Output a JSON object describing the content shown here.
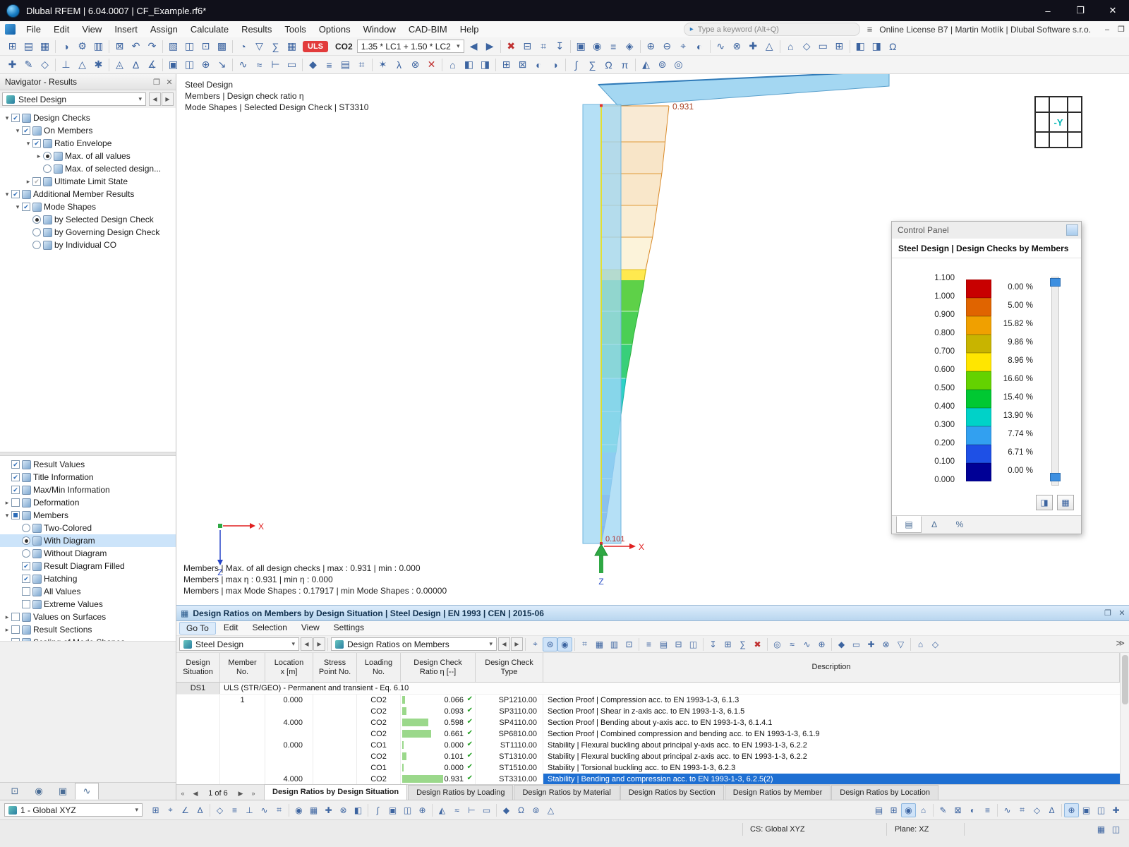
{
  "ui": {
    "dd": "▾",
    "prev": "◀",
    "next": "▶",
    "close": "✕",
    "float": "❐",
    "pin": "▣",
    "menu": "≡",
    "min": "–",
    "max": "❐",
    "search_arrow": "▸",
    "pager_first": "«",
    "pager_prev": "◀",
    "pager_next": "▶",
    "pager_last": "»",
    "overflow": "≫"
  },
  "titlebar": {
    "app_title": "Dlubal RFEM | 6.04.0007 | CF_Example.rf6*",
    "window_buttons": {
      "minimize": "–",
      "maximize": "❐",
      "close": "✕"
    }
  },
  "menubar": {
    "items": [
      "File",
      "Edit",
      "View",
      "Insert",
      "Assign",
      "Calculate",
      "Results",
      "Tools",
      "Options",
      "Window",
      "CAD-BIM",
      "Help"
    ],
    "search_placeholder": "Type a keyword (Alt+Q)",
    "license_text": "Online License B7 | Martin Motlík | Dlubal Software s.r.o."
  },
  "toolbar": {
    "uls_badge": "ULS",
    "co_label": "CO2",
    "load_combo_value": "1.35 * LC1 + 1.50 * LC2",
    "row1_icons_a": [
      "⊞",
      "▤",
      "▦",
      "|",
      "◑",
      "⚙",
      "▥",
      "|",
      "⊠",
      "↶",
      "↷",
      "|",
      "▧",
      "◫",
      "⊡",
      "▩",
      "|",
      "◔",
      "▽",
      "∑",
      "▦"
    ],
    "row1_icons_b": [
      "◀",
      "▶",
      "|",
      "✖",
      "⊟",
      "⌗",
      "↧",
      "|",
      "▣",
      "◉",
      "≡",
      "◈",
      "|",
      "⊕",
      "⊖",
      "⌖",
      "◐",
      "|",
      "∿",
      "⊗",
      "✚",
      "△",
      "|",
      "⌂",
      "◇",
      "▭",
      "⊞",
      "|",
      "◧",
      "◨",
      "Ω"
    ],
    "row2_icons": [
      "✚",
      "✎",
      "◇",
      "|",
      "⊥",
      "△",
      "✱",
      "|",
      "◬",
      "∆",
      "∡",
      "|",
      "▣",
      "◫",
      "⊕",
      "↘",
      "|",
      "∿",
      "≈",
      "⊢",
      "▭",
      "|",
      "◆",
      "≡",
      "▤",
      "⌗",
      "|",
      "✶",
      "λ",
      "⊗",
      "✕",
      "|",
      "⌂",
      "◧",
      "◨",
      "|",
      "⊞",
      "⊠",
      "◐",
      "◑",
      "|",
      "∫",
      "∑",
      "Ω",
      "π",
      "|",
      "◭",
      "⊚",
      "◎"
    ]
  },
  "navigator": {
    "panel_title": "Navigator - Results",
    "combo_value": "Steel Design",
    "tree_top": [
      {
        "lvl": 0,
        "exp": "open",
        "ctrl": "checkbox",
        "state": "checked",
        "label": "Design Checks"
      },
      {
        "lvl": 1,
        "exp": "open",
        "ctrl": "checkbox",
        "state": "checked",
        "label": "On Members"
      },
      {
        "lvl": 2,
        "exp": "open",
        "ctrl": "checkbox",
        "state": "checked",
        "label": "Ratio Envelope"
      },
      {
        "lvl": 3,
        "exp": "closed",
        "ctrl": "radio",
        "state": "selected",
        "label": "Max. of all values"
      },
      {
        "lvl": 3,
        "exp": "none",
        "ctrl": "radio",
        "state": "unselected",
        "label": "Max. of selected design..."
      },
      {
        "lvl": 2,
        "exp": "closed",
        "ctrl": "checkbox",
        "state": "checked-dim",
        "label": "Ultimate Limit State"
      },
      {
        "lvl": 0,
        "exp": "open",
        "ctrl": "checkbox",
        "state": "checked",
        "label": "Additional Member Results"
      },
      {
        "lvl": 1,
        "exp": "open",
        "ctrl": "checkbox",
        "state": "checked",
        "label": "Mode Shapes"
      },
      {
        "lvl": 2,
        "exp": "none",
        "ctrl": "radio",
        "state": "selected",
        "label": "by Selected Design Check"
      },
      {
        "lvl": 2,
        "exp": "none",
        "ctrl": "radio",
        "state": "unselected",
        "label": "by Governing Design Check"
      },
      {
        "lvl": 2,
        "exp": "none",
        "ctrl": "radio",
        "state": "unselected",
        "label": "by Individual CO"
      }
    ],
    "tree_bottom": [
      {
        "lvl": 0,
        "exp": "none",
        "ctrl": "checkbox",
        "state": "checked",
        "label": "Result Values"
      },
      {
        "lvl": 0,
        "exp": "none",
        "ctrl": "checkbox",
        "state": "checked",
        "label": "Title Information"
      },
      {
        "lvl": 0,
        "exp": "none",
        "ctrl": "checkbox",
        "state": "checked",
        "label": "Max/Min Information"
      },
      {
        "lvl": 0,
        "exp": "closed",
        "ctrl": "checkbox",
        "state": "unchecked",
        "label": "Deformation"
      },
      {
        "lvl": 0,
        "exp": "open",
        "ctrl": "checkbox",
        "state": "partial",
        "label": "Members"
      },
      {
        "lvl": 1,
        "exp": "none",
        "ctrl": "radio",
        "state": "unselected",
        "label": "Two-Colored"
      },
      {
        "lvl": 1,
        "exp": "none",
        "ctrl": "radio",
        "state": "selected",
        "label": "With Diagram",
        "highlight": true
      },
      {
        "lvl": 1,
        "exp": "none",
        "ctrl": "radio",
        "state": "unselected",
        "label": "Without Diagram"
      },
      {
        "lvl": 1,
        "exp": "none",
        "ctrl": "checkbox",
        "state": "checked",
        "label": "Result Diagram Filled"
      },
      {
        "lvl": 1,
        "exp": "none",
        "ctrl": "checkbox",
        "state": "checked",
        "label": "Hatching"
      },
      {
        "lvl": 1,
        "exp": "none",
        "ctrl": "checkbox",
        "state": "unchecked",
        "label": "All Values"
      },
      {
        "lvl": 1,
        "exp": "none",
        "ctrl": "checkbox",
        "state": "unchecked",
        "label": "Extreme Values"
      },
      {
        "lvl": 0,
        "exp": "closed",
        "ctrl": "checkbox",
        "state": "unchecked",
        "label": "Values on Surfaces"
      },
      {
        "lvl": 0,
        "exp": "closed",
        "ctrl": "checkbox",
        "state": "unchecked",
        "label": "Result Sections"
      },
      {
        "lvl": 0,
        "exp": "closed",
        "ctrl": "checkbox",
        "state": "unchecked",
        "label": "Scaling of Mode Shapes"
      }
    ],
    "bottom_tabs": [
      {
        "glyph": "⊡",
        "name": "views"
      },
      {
        "glyph": "◉",
        "name": "visibility"
      },
      {
        "glyph": "▣",
        "name": "camera"
      },
      {
        "glyph": "∿",
        "name": "results",
        "active": true
      }
    ]
  },
  "viewport": {
    "header_lines": [
      "Steel Design",
      "Members | Design check ratio η",
      "Mode Shapes | Selected Design Check | ST3310"
    ],
    "footer_lines": [
      "Members | Max. of all design checks | max : 0.931 | min : 0.000",
      "Members | max η : 0.931 | min η : 0.000",
      "Members | max Mode Shapes : 0.17917 | min Mode Shapes : 0.00000"
    ],
    "max_value_label": "0.931",
    "base_value_label": "0.101",
    "axis_x_label": "X",
    "axis_z_label": "Z",
    "support_axis_label": "Z",
    "view_cube_label": "-Y"
  },
  "control_panel": {
    "title": "Control Panel",
    "subtitle": "Steel Design | Design Checks by Members",
    "scale_values": [
      "1.100",
      "1.000",
      "0.900",
      "0.800",
      "0.700",
      "0.600",
      "0.500",
      "0.400",
      "0.300",
      "0.200",
      "0.100",
      "0.000"
    ],
    "scale_segments": [
      {
        "color": "#c80000",
        "pct": "0.00 %"
      },
      {
        "color": "#e06400",
        "pct": "5.00 %"
      },
      {
        "color": "#f0a000",
        "pct": "15.82 %"
      },
      {
        "color": "#c8b400",
        "pct": "9.86 %"
      },
      {
        "color": "#ffe600",
        "pct": "8.96 %"
      },
      {
        "color": "#64d200",
        "pct": "16.60 %"
      },
      {
        "color": "#00c832",
        "pct": "15.40 %"
      },
      {
        "color": "#00d2c8",
        "pct": "13.90 %"
      },
      {
        "color": "#32a0f0",
        "pct": "7.74 %"
      },
      {
        "color": "#1e50e6",
        "pct": "6.71 %"
      },
      {
        "color": "#000096",
        "pct": "0.00 %"
      }
    ],
    "buttons": [
      {
        "glyph": "◨",
        "name": "scale-settings"
      },
      {
        "glyph": "▦",
        "name": "panel-options"
      }
    ],
    "tabs": [
      {
        "glyph": "▤",
        "name": "color-scale",
        "active": true
      },
      {
        "glyph": "∆",
        "name": "display-factors"
      },
      {
        "glyph": "%",
        "name": "filter"
      }
    ]
  },
  "table_panel": {
    "table_icon": "▦",
    "title": "Design Ratios on Members by Design Situation | Steel Design | EN 1993 | CEN | 2015-06",
    "menu": [
      "Go To",
      "Edit",
      "Selection",
      "View",
      "Settings"
    ],
    "combo1_value": "Steel Design",
    "combo2_value": "Design Ratios on Members",
    "toolbar_icons": [
      "⌖",
      "*⊛",
      "*◉",
      "|",
      "⌗",
      "▦",
      "▥",
      "⊡",
      "|",
      "≡",
      "▤",
      "⊟",
      "◫",
      "|",
      "↧",
      "⊞",
      "∑",
      "✖",
      "|",
      "◎",
      "≈",
      "∿",
      "⊕",
      "|",
      "◆",
      "▭",
      "✚",
      "⊗",
      "▽",
      "|",
      "⌂",
      "◇"
    ],
    "columns": [
      {
        "l1": "Design",
        "l2": "Situation"
      },
      {
        "l1": "Member",
        "l2": "No."
      },
      {
        "l1": "Location",
        "l2": "x [m]"
      },
      {
        "l1": "Stress",
        "l2": "Point No."
      },
      {
        "l1": "Loading",
        "l2": "No."
      },
      {
        "l1": "Design Check",
        "l2": "Ratio η [--]"
      },
      {
        "l1": "Design Check",
        "l2": "Type"
      },
      {
        "l1": "Description",
        "l2": ""
      }
    ],
    "group_ds": "DS1",
    "group_title": "ULS (STR/GEO) - Permanent and transient - Eq. 6.10",
    "rows": [
      {
        "member": "1",
        "loc": "0.000",
        "load": "CO2",
        "ratio": "0.066",
        "type": "SP1210.00",
        "desc": "Section Proof | Compression acc. to EN 1993-1-3, 6.1.3"
      },
      {
        "member": "",
        "loc": "",
        "load": "CO2",
        "ratio": "0.093",
        "type": "SP3110.00",
        "desc": "Section Proof | Shear in z-axis acc. to EN 1993-1-3, 6.1.5"
      },
      {
        "member": "",
        "loc": "4.000",
        "load": "CO2",
        "ratio": "0.598",
        "type": "SP4110.00",
        "desc": "Section Proof | Bending about y-axis acc. to E​N 1993-1-3, 6.1.4.1"
      },
      {
        "member": "",
        "loc": "",
        "load": "CO2",
        "ratio": "0.661",
        "type": "SP6810.00",
        "desc": "Section Proof | Combined compression and bending acc. to EN 1993-1-3, 6.1.9"
      },
      {
        "member": "",
        "loc": "0.000",
        "load": "CO1",
        "ratio": "0.000",
        "type": "ST1110.00",
        "desc": "Stability | Flexural buckling about principal y-axis acc. to EN 1993-1-3, 6.2.2"
      },
      {
        "member": "",
        "loc": "",
        "load": "CO2",
        "ratio": "0.101",
        "type": "ST1310.00",
        "desc": "Stability | Flexural buckling about principal z-axis acc. to EN 1993-1-3, 6.2.2"
      },
      {
        "member": "",
        "loc": "",
        "load": "CO1",
        "ratio": "0.000",
        "type": "ST1510.00",
        "desc": "Stability | Torsional buckling acc. to EN 1993-1-3, 6.2.3"
      },
      {
        "member": "",
        "loc": "4.000",
        "load": "CO2",
        "ratio": "0.931",
        "type": "ST3310.00",
        "desc": "Stability | Bending and compression acc. to EN 1993-1-3, 6.2.5(2)",
        "selected": true
      }
    ],
    "pager": "1 of 6",
    "active_tab": 0,
    "tabs": [
      "Design Ratios by Design Situation",
      "Design Ratios by Loading",
      "Design Ratios by Material",
      "Design Ratios by Section",
      "Design Ratios by Member",
      "Design Ratios by Location"
    ]
  },
  "statusbar": {
    "combo_value": "1 - Global XYZ",
    "cs_label": "CS: Global XYZ",
    "plane_label": "Plane: XZ",
    "icons_left": [
      "⊞",
      "⌖",
      "∠",
      "∆",
      "|",
      "◇",
      "≡",
      "⊥",
      "∿",
      "⌗",
      "|",
      "◉",
      "▦",
      "✚",
      "⊗",
      "◧",
      "|",
      "∫",
      "▣",
      "◫",
      "⊕",
      "|",
      "◭",
      "≈",
      "⊢",
      "▭",
      "|",
      "◆",
      "Ω",
      "⊚",
      "△"
    ],
    "icons_right": [
      "▤",
      "⊞",
      "*◉",
      "⌂",
      "|",
      "✎",
      "⊠",
      "◐",
      "≡",
      "|",
      "∿",
      "⌗",
      "◇",
      "∆",
      "|",
      "*⊕",
      "▣",
      "◫",
      "✚"
    ],
    "icons_far_right": [
      "▦",
      "◫"
    ]
  }
}
